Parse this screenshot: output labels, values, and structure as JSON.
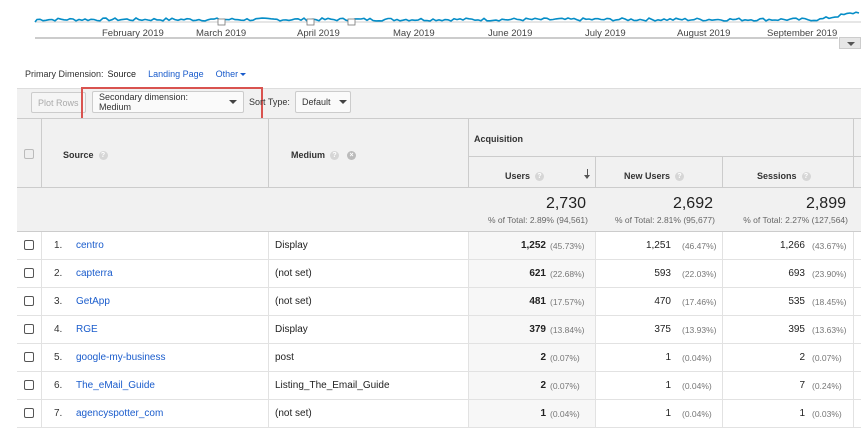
{
  "timeline": {
    "months": [
      "February 2019",
      "March 2019",
      "April 2019",
      "May 2019",
      "June 2019",
      "July 2019",
      "August 2019",
      "September 2019"
    ],
    "line_color": "#058dc7"
  },
  "primary_dimension": {
    "label": "Primary Dimension:",
    "current": "Source",
    "options": [
      "Landing Page",
      "Other"
    ]
  },
  "toolbar": {
    "plot_rows": "Plot Rows",
    "secondary_dimension": "Secondary dimension: Medium",
    "sort_type_label": "Sort Type:",
    "sort_type_value": "Default"
  },
  "table": {
    "group_header": "Acquisition",
    "columns": {
      "source": "Source",
      "medium": "Medium",
      "users": "Users",
      "new_users": "New Users",
      "sessions": "Sessions"
    },
    "totals": {
      "users": "2,730",
      "users_sub": "% of Total: 2.89% (94,561)",
      "new_users": "2,692",
      "new_users_sub": "% of Total: 2.81% (95,677)",
      "sessions": "2,899",
      "sessions_sub": "% of Total: 2.27% (127,564)"
    },
    "rows": [
      {
        "idx": "1.",
        "source": "centro",
        "medium": "Display",
        "users": "1,252",
        "users_pct": "(45.73%)",
        "new_users": "1,251",
        "new_users_pct": "(46.47%)",
        "sessions": "1,266",
        "sessions_pct": "(43.67%)"
      },
      {
        "idx": "2.",
        "source": "capterra",
        "medium": "(not set)",
        "users": "621",
        "users_pct": "(22.68%)",
        "new_users": "593",
        "new_users_pct": "(22.03%)",
        "sessions": "693",
        "sessions_pct": "(23.90%)"
      },
      {
        "idx": "3.",
        "source": "GetApp",
        "medium": "(not set)",
        "users": "481",
        "users_pct": "(17.57%)",
        "new_users": "470",
        "new_users_pct": "(17.46%)",
        "sessions": "535",
        "sessions_pct": "(18.45%)"
      },
      {
        "idx": "4.",
        "source": "RGE",
        "medium": "Display",
        "users": "379",
        "users_pct": "(13.84%)",
        "new_users": "375",
        "new_users_pct": "(13.93%)",
        "sessions": "395",
        "sessions_pct": "(13.63%)"
      },
      {
        "idx": "5.",
        "source": "google-my-business",
        "medium": "post",
        "users": "2",
        "users_pct": "(0.07%)",
        "new_users": "1",
        "new_users_pct": "(0.04%)",
        "sessions": "2",
        "sessions_pct": "(0.07%)"
      },
      {
        "idx": "6.",
        "source": "The_eMail_Guide",
        "medium": "Listing_The_Email_Guide",
        "users": "2",
        "users_pct": "(0.07%)",
        "new_users": "1",
        "new_users_pct": "(0.04%)",
        "sessions": "7",
        "sessions_pct": "(0.24%)"
      },
      {
        "idx": "7.",
        "source": "agencyspotter_com",
        "medium": "(not set)",
        "users": "1",
        "users_pct": "(0.04%)",
        "new_users": "1",
        "new_users_pct": "(0.04%)",
        "sessions": "1",
        "sessions_pct": "(0.03%)"
      }
    ]
  }
}
